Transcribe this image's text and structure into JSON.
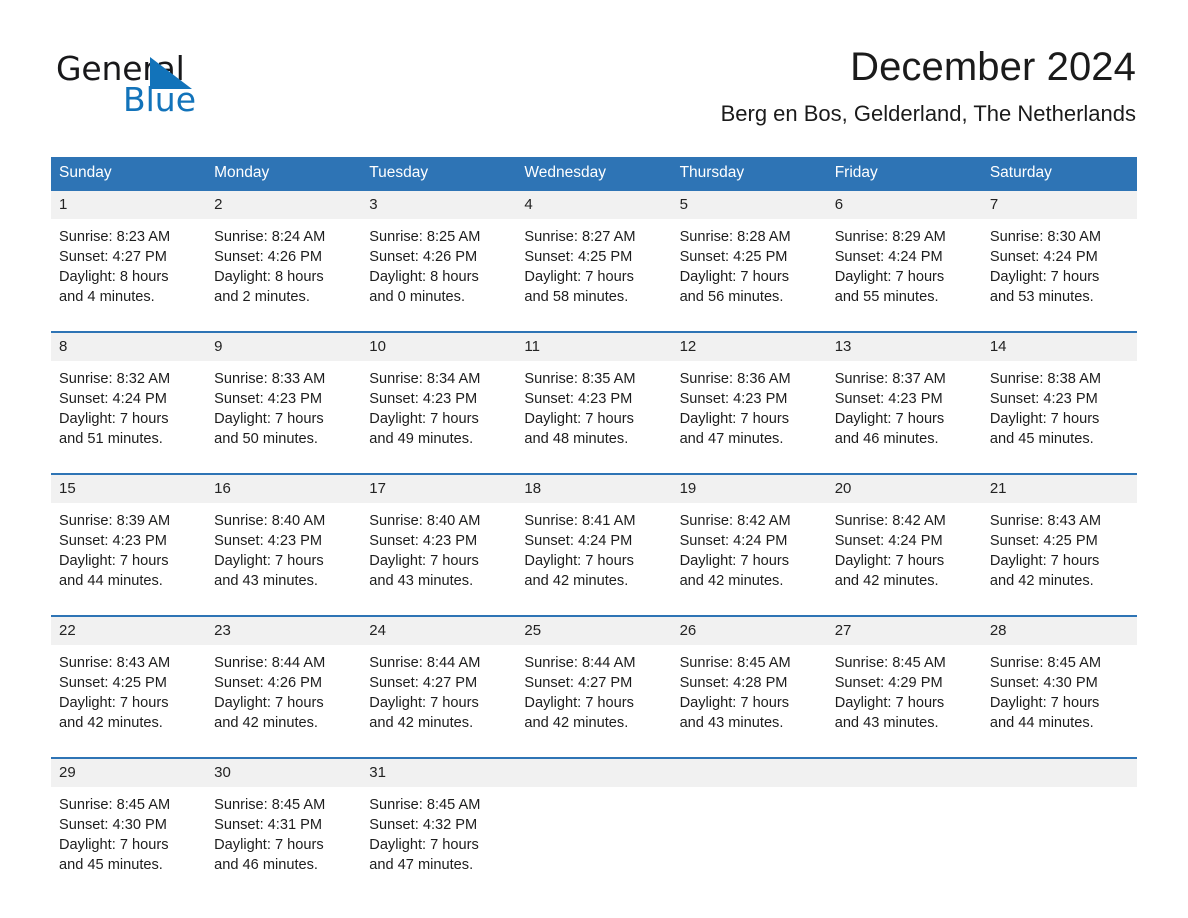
{
  "logo": {
    "word1": "General",
    "word2": "Blue",
    "triangle_color": "#1273ba"
  },
  "header": {
    "title": "December 2024",
    "subtitle": "Berg en Bos, Gelderland, The Netherlands",
    "accent_color": "#2e74b5",
    "daynum_band_color": "#f1f1f1"
  },
  "calendar": {
    "weekday_headers": [
      "Sunday",
      "Monday",
      "Tuesday",
      "Wednesday",
      "Thursday",
      "Friday",
      "Saturday"
    ],
    "weeks": [
      [
        {
          "day": "1",
          "lines": [
            "Sunrise: 8:23 AM",
            "Sunset: 4:27 PM",
            "Daylight: 8 hours",
            "and 4 minutes."
          ]
        },
        {
          "day": "2",
          "lines": [
            "Sunrise: 8:24 AM",
            "Sunset: 4:26 PM",
            "Daylight: 8 hours",
            "and 2 minutes."
          ]
        },
        {
          "day": "3",
          "lines": [
            "Sunrise: 8:25 AM",
            "Sunset: 4:26 PM",
            "Daylight: 8 hours",
            "and 0 minutes."
          ]
        },
        {
          "day": "4",
          "lines": [
            "Sunrise: 8:27 AM",
            "Sunset: 4:25 PM",
            "Daylight: 7 hours",
            "and 58 minutes."
          ]
        },
        {
          "day": "5",
          "lines": [
            "Sunrise: 8:28 AM",
            "Sunset: 4:25 PM",
            "Daylight: 7 hours",
            "and 56 minutes."
          ]
        },
        {
          "day": "6",
          "lines": [
            "Sunrise: 8:29 AM",
            "Sunset: 4:24 PM",
            "Daylight: 7 hours",
            "and 55 minutes."
          ]
        },
        {
          "day": "7",
          "lines": [
            "Sunrise: 8:30 AM",
            "Sunset: 4:24 PM",
            "Daylight: 7 hours",
            "and 53 minutes."
          ]
        }
      ],
      [
        {
          "day": "8",
          "lines": [
            "Sunrise: 8:32 AM",
            "Sunset: 4:24 PM",
            "Daylight: 7 hours",
            "and 51 minutes."
          ]
        },
        {
          "day": "9",
          "lines": [
            "Sunrise: 8:33 AM",
            "Sunset: 4:23 PM",
            "Daylight: 7 hours",
            "and 50 minutes."
          ]
        },
        {
          "day": "10",
          "lines": [
            "Sunrise: 8:34 AM",
            "Sunset: 4:23 PM",
            "Daylight: 7 hours",
            "and 49 minutes."
          ]
        },
        {
          "day": "11",
          "lines": [
            "Sunrise: 8:35 AM",
            "Sunset: 4:23 PM",
            "Daylight: 7 hours",
            "and 48 minutes."
          ]
        },
        {
          "day": "12",
          "lines": [
            "Sunrise: 8:36 AM",
            "Sunset: 4:23 PM",
            "Daylight: 7 hours",
            "and 47 minutes."
          ]
        },
        {
          "day": "13",
          "lines": [
            "Sunrise: 8:37 AM",
            "Sunset: 4:23 PM",
            "Daylight: 7 hours",
            "and 46 minutes."
          ]
        },
        {
          "day": "14",
          "lines": [
            "Sunrise: 8:38 AM",
            "Sunset: 4:23 PM",
            "Daylight: 7 hours",
            "and 45 minutes."
          ]
        }
      ],
      [
        {
          "day": "15",
          "lines": [
            "Sunrise: 8:39 AM",
            "Sunset: 4:23 PM",
            "Daylight: 7 hours",
            "and 44 minutes."
          ]
        },
        {
          "day": "16",
          "lines": [
            "Sunrise: 8:40 AM",
            "Sunset: 4:23 PM",
            "Daylight: 7 hours",
            "and 43 minutes."
          ]
        },
        {
          "day": "17",
          "lines": [
            "Sunrise: 8:40 AM",
            "Sunset: 4:23 PM",
            "Daylight: 7 hours",
            "and 43 minutes."
          ]
        },
        {
          "day": "18",
          "lines": [
            "Sunrise: 8:41 AM",
            "Sunset: 4:24 PM",
            "Daylight: 7 hours",
            "and 42 minutes."
          ]
        },
        {
          "day": "19",
          "lines": [
            "Sunrise: 8:42 AM",
            "Sunset: 4:24 PM",
            "Daylight: 7 hours",
            "and 42 minutes."
          ]
        },
        {
          "day": "20",
          "lines": [
            "Sunrise: 8:42 AM",
            "Sunset: 4:24 PM",
            "Daylight: 7 hours",
            "and 42 minutes."
          ]
        },
        {
          "day": "21",
          "lines": [
            "Sunrise: 8:43 AM",
            "Sunset: 4:25 PM",
            "Daylight: 7 hours",
            "and 42 minutes."
          ]
        }
      ],
      [
        {
          "day": "22",
          "lines": [
            "Sunrise: 8:43 AM",
            "Sunset: 4:25 PM",
            "Daylight: 7 hours",
            "and 42 minutes."
          ]
        },
        {
          "day": "23",
          "lines": [
            "Sunrise: 8:44 AM",
            "Sunset: 4:26 PM",
            "Daylight: 7 hours",
            "and 42 minutes."
          ]
        },
        {
          "day": "24",
          "lines": [
            "Sunrise: 8:44 AM",
            "Sunset: 4:27 PM",
            "Daylight: 7 hours",
            "and 42 minutes."
          ]
        },
        {
          "day": "25",
          "lines": [
            "Sunrise: 8:44 AM",
            "Sunset: 4:27 PM",
            "Daylight: 7 hours",
            "and 42 minutes."
          ]
        },
        {
          "day": "26",
          "lines": [
            "Sunrise: 8:45 AM",
            "Sunset: 4:28 PM",
            "Daylight: 7 hours",
            "and 43 minutes."
          ]
        },
        {
          "day": "27",
          "lines": [
            "Sunrise: 8:45 AM",
            "Sunset: 4:29 PM",
            "Daylight: 7 hours",
            "and 43 minutes."
          ]
        },
        {
          "day": "28",
          "lines": [
            "Sunrise: 8:45 AM",
            "Sunset: 4:30 PM",
            "Daylight: 7 hours",
            "and 44 minutes."
          ]
        }
      ],
      [
        {
          "day": "29",
          "lines": [
            "Sunrise: 8:45 AM",
            "Sunset: 4:30 PM",
            "Daylight: 7 hours",
            "and 45 minutes."
          ]
        },
        {
          "day": "30",
          "lines": [
            "Sunrise: 8:45 AM",
            "Sunset: 4:31 PM",
            "Daylight: 7 hours",
            "and 46 minutes."
          ]
        },
        {
          "day": "31",
          "lines": [
            "Sunrise: 8:45 AM",
            "Sunset: 4:32 PM",
            "Daylight: 7 hours",
            "and 47 minutes."
          ]
        },
        {
          "day": "",
          "lines": []
        },
        {
          "day": "",
          "lines": []
        },
        {
          "day": "",
          "lines": []
        },
        {
          "day": "",
          "lines": []
        }
      ]
    ]
  }
}
